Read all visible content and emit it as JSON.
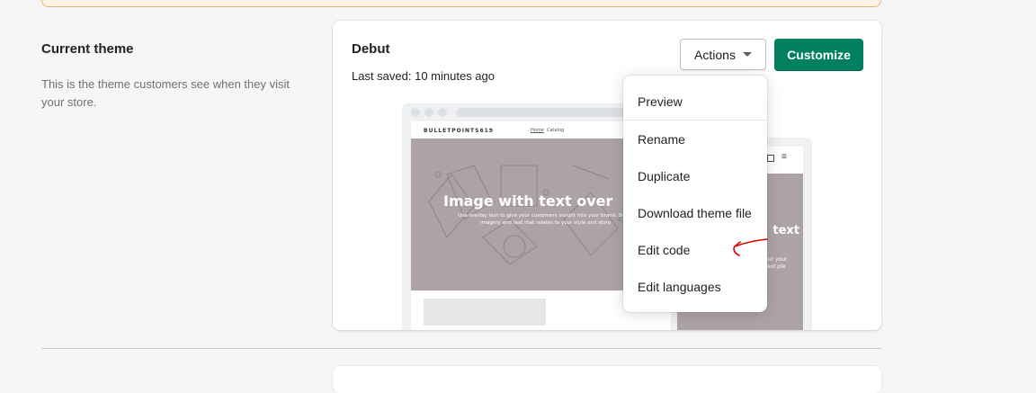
{
  "section": {
    "title": "Current theme",
    "description": "This is the theme customers see when they visit your store."
  },
  "theme": {
    "name": "Debut",
    "last_saved": "Last saved: 10 minutes ago"
  },
  "buttons": {
    "actions_label": "Actions",
    "customize_label": "Customize",
    "customize_color": "#008060"
  },
  "actions_menu": {
    "items": [
      {
        "label": "Preview"
      },
      {
        "label": "Rename"
      },
      {
        "label": "Duplicate"
      },
      {
        "label": "Download theme file"
      },
      {
        "label": "Edit code"
      },
      {
        "label": "Edit languages"
      }
    ]
  },
  "preview": {
    "store_name": "BULLETPOINTS619",
    "nav": [
      "Home",
      "Catalog"
    ],
    "hero_title": "Image with text over",
    "hero_text": "Use overlay text to give your customers insight into your brand. Select imagery and text that relates to your style and story.",
    "mobile_hero_title": "text",
    "mobile_hero_text": "e your your nd text ple and",
    "hero_color": "#ada3a4"
  },
  "annotation": {
    "arrow_color": "#e00000",
    "points_to": "Edit code"
  }
}
